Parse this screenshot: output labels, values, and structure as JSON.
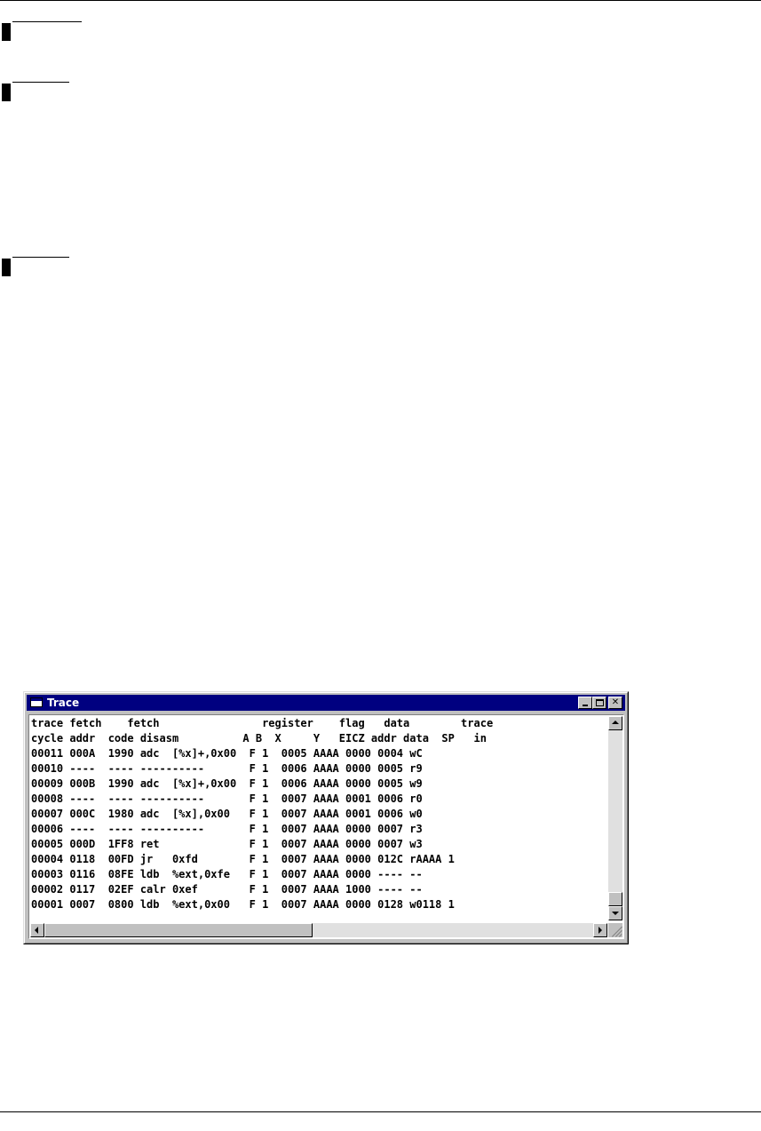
{
  "window": {
    "title": "Trace",
    "icon": "window-icon",
    "controls": [
      "minimize",
      "maximize",
      "close"
    ]
  },
  "trace": {
    "header_lines": [
      "trace fetch    fetch                register    flag   data        trace",
      "cycle addr  code disasm          A B  X     Y   EICZ addr data  SP   in"
    ],
    "rows": [
      "00011 000A  1990 adc  [%x]+,0x00  F 1  0005 AAAA 0000 0004 wC",
      "00010 ----  ---- ----------       F 1  0006 AAAA 0000 0005 r9",
      "00009 000B  1990 adc  [%x]+,0x00  F 1  0006 AAAA 0000 0005 w9",
      "00008 ----  ---- ----------       F 1  0007 AAAA 0001 0006 r0",
      "00007 000C  1980 adc  [%x],0x00   F 1  0007 AAAA 0001 0006 w0",
      "00006 ----  ---- ----------       F 1  0007 AAAA 0000 0007 r3",
      "00005 000D  1FF8 ret              F 1  0007 AAAA 0000 0007 w3",
      "00004 0118  00FD jr   0xfd        F 1  0007 AAAA 0000 012C rAAAA 1",
      "00003 0116  08FE ldb  %ext,0xfe   F 1  0007 AAAA 0000 ---- --",
      "00002 0117  02EF calr 0xef        F 1  0007 AAAA 1000 ---- --",
      "00001 0007  0800 ldb  %ext,0x00   F 1  0007 AAAA 0000 0128 w0118 1"
    ]
  },
  "colors": {
    "titlebar": "#000080",
    "window_face": "#c0c0c0",
    "client_bg": "#ffffff"
  }
}
